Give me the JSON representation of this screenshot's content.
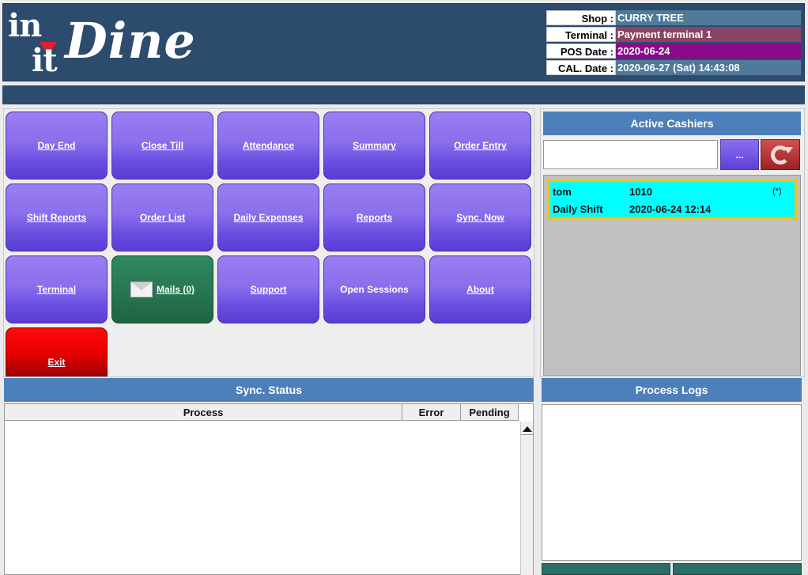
{
  "logo": {
    "line1": "in",
    "line2": "it",
    "brand": "Dine"
  },
  "info": [
    {
      "label": "Shop :",
      "value": "CURRY TREE",
      "color": "#4f7a9a"
    },
    {
      "label": "Terminal :",
      "value": "Payment terminal 1",
      "color": "#8a4564"
    },
    {
      "label": "POS Date :",
      "value": "2020-06-24",
      "color": "#8a0a8a"
    },
    {
      "label": "CAL. Date :",
      "value": "2020-06-27 (Sat) 14:43:08",
      "color": "#4f7a9a"
    }
  ],
  "buttons": {
    "day_end": "Day End",
    "close_till": "Close Till",
    "attendance": "Attendance",
    "summary": "Summary",
    "order_entry": "Order Entry",
    "shift_reports": "Shift Reports",
    "order_list": "Order List",
    "daily_expenses": "Daily Expenses",
    "reports": "Reports",
    "sync_now": "Sync. Now",
    "terminal": "Terminal",
    "mails": "Mails (0)",
    "support": "Support",
    "open_sessions": "Open Sessions",
    "about": "About",
    "exit": "Exit"
  },
  "cashiers": {
    "title": "Active Cashiers",
    "search_value": "",
    "dots_label": "...",
    "items": [
      {
        "name": "tom",
        "code": "1010",
        "marker": "(*)",
        "shift": "Daily Shift",
        "time": "2020-06-24 12:14"
      }
    ]
  },
  "sync": {
    "title": "Sync. Status",
    "columns": [
      "Process",
      "Error",
      "Pending"
    ]
  },
  "logs": {
    "title": "Process Logs"
  },
  "colors": {
    "header": "#2d4b6c",
    "button_purple": "#7b5ee8",
    "mail_green": "#26734f",
    "exit_red": "#e50000",
    "panel_head": "#4d80bb",
    "cashier_bg": "#00ffff"
  }
}
